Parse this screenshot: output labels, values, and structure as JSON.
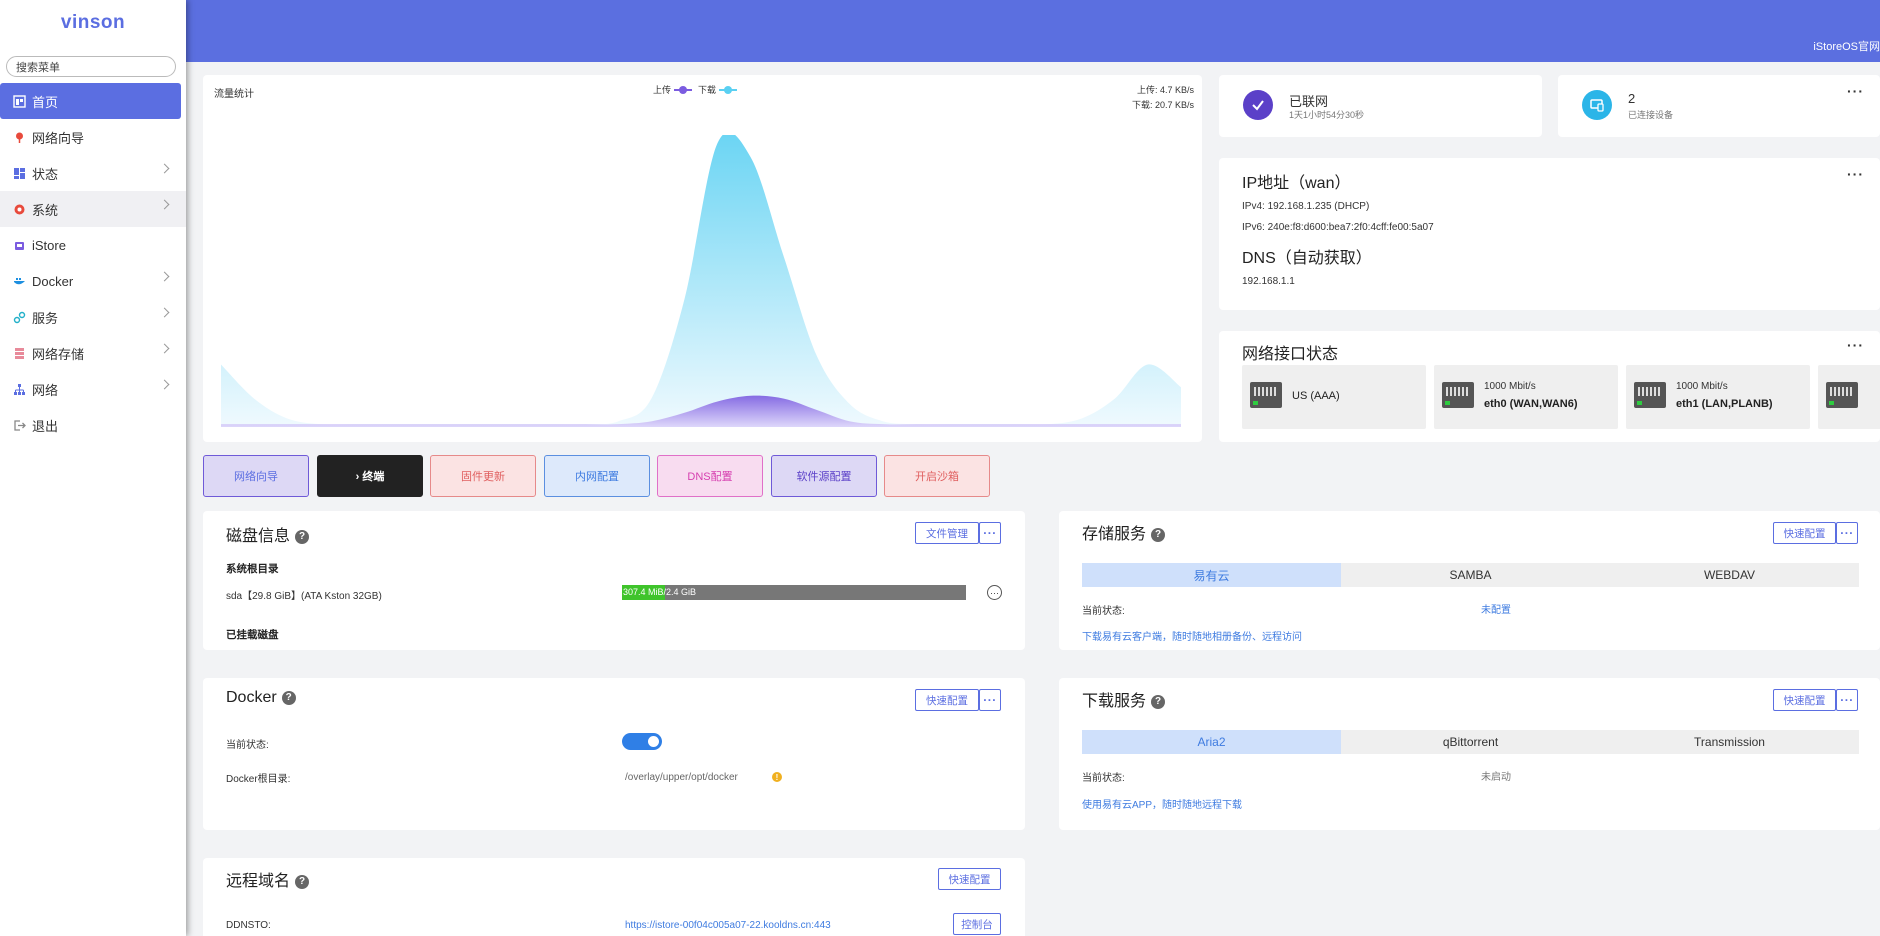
{
  "sidebar": {
    "logo": "vinson",
    "search_placeholder": "搜索菜单",
    "items": [
      {
        "label": "首页",
        "icon": "home-icon",
        "active": true
      },
      {
        "label": "网络向导",
        "icon": "wizard-icon"
      },
      {
        "label": "状态",
        "icon": "dashboard-icon",
        "has_children": true
      },
      {
        "label": "系统",
        "icon": "gear-icon",
        "has_children": true
      },
      {
        "label": "iStore",
        "icon": "store-icon"
      },
      {
        "label": "Docker",
        "icon": "docker-icon",
        "has_children": true
      },
      {
        "label": "服务",
        "icon": "services-icon",
        "has_children": true
      },
      {
        "label": "网络存储",
        "icon": "storage-icon",
        "has_children": true
      },
      {
        "label": "网络",
        "icon": "network-icon",
        "has_children": true
      },
      {
        "label": "退出",
        "icon": "logout-icon"
      }
    ]
  },
  "topbar": {
    "link": "iStoreOS官网"
  },
  "traffic": {
    "title": "流量统计",
    "legend_upload": "上传",
    "legend_download": "下载",
    "upload_rate": "上传: 4.7 KB/s",
    "download_rate": "下载: 20.7 KB/s"
  },
  "chart_data": {
    "type": "area",
    "title": "流量统计",
    "series": [
      {
        "name": "上传",
        "color": "#7b5ce0",
        "values": [
          1,
          1,
          1,
          1,
          1,
          1,
          1,
          1,
          1,
          1,
          1,
          1,
          1,
          2,
          5,
          9,
          11,
          10,
          6,
          2,
          1,
          1,
          1,
          1,
          1,
          1,
          1,
          1,
          1,
          1
        ]
      },
      {
        "name": "下载",
        "color": "#5ad0f2",
        "values": [
          22,
          10,
          3,
          1,
          1,
          1,
          1,
          1,
          1,
          1,
          1,
          1,
          2,
          10,
          45,
          100,
          95,
          60,
          25,
          8,
          2,
          1,
          1,
          1,
          1,
          1,
          3,
          10,
          22,
          14
        ]
      }
    ],
    "grid": false,
    "legend": "top-center",
    "colors": {
      "upload": "#7b5ce0",
      "download": "#5ad0f2"
    }
  },
  "status": {
    "online_label": "已联网",
    "uptime": "1天1小时54分30秒",
    "devices_count": "2",
    "devices_label": "已连接设备"
  },
  "ip": {
    "title": "IP地址（wan）",
    "ipv4": "IPv4: 192.168.1.235   (DHCP)",
    "ipv6": "IPv6: 240e:f8:d600:bea7:2f0:4cff:fe00:5a07",
    "dns_title": "DNS（自动获取）",
    "dns": "192.168.1.1"
  },
  "interfaces": {
    "title": "网络接口状态",
    "ports": [
      {
        "speed": "",
        "name": "US (AAA)"
      },
      {
        "speed": "1000 Mbit/s",
        "name": "eth0 (WAN,WAN6)"
      },
      {
        "speed": "1000 Mbit/s",
        "name": "eth1 (LAN,PLANB)"
      }
    ]
  },
  "quick_buttons": [
    {
      "label": "网络向导",
      "bg": "#ddd8f5",
      "border": "#6f5ad8",
      "color": "#5b6ee1"
    },
    {
      "label": "› 终端",
      "bg": "#222222",
      "border": "#222222",
      "color": "#ffffff"
    },
    {
      "label": "固件更新",
      "bg": "#fbe3e3",
      "border": "#e68a8a",
      "color": "#e06060"
    },
    {
      "label": "内网配置",
      "bg": "#dde9fb",
      "border": "#5b8fe0",
      "color": "#3e7be0"
    },
    {
      "label": "DNS配置",
      "bg": "#f8dcf0",
      "border": "#e070c8",
      "color": "#d63faf"
    },
    {
      "label": "软件源配置",
      "bg": "#ddd8f5",
      "border": "#6f5ad8",
      "color": "#5b40c8"
    },
    {
      "label": "开启沙箱",
      "bg": "#fbe3e3",
      "border": "#e68a8a",
      "color": "#e06060"
    }
  ],
  "disk": {
    "title": "磁盘信息",
    "file_mgmt": "文件管理",
    "root_label": "系统根目录",
    "device": "sda【29.8 GiB】(ATA Kston 32GB)",
    "usage": "307.4 MiB/2.4 GiB",
    "usage_fraction": 0.125,
    "mounted_label": "已挂载磁盘"
  },
  "storage": {
    "title": "存储服务",
    "quick": "快速配置",
    "tabs": [
      "易有云",
      "SAMBA",
      "WEBDAV"
    ],
    "status_label": "当前状态:",
    "status_value": "未配置",
    "link": "下载易有云客户端，随时随地相册备份、远程访问"
  },
  "docker": {
    "title": "Docker",
    "quick": "快速配置",
    "status_label": "当前状态:",
    "enabled": true,
    "root_label": "Docker根目录:",
    "root_value": "/overlay/upper/opt/docker"
  },
  "download": {
    "title": "下载服务",
    "quick": "快速配置",
    "tabs": [
      "Aria2",
      "qBittorrent",
      "Transmission"
    ],
    "status_label": "当前状态:",
    "status_value": "未启动",
    "link": "使用易有云APP，随时随地远程下载"
  },
  "ddns": {
    "title": "远程域名",
    "quick": "快速配置",
    "label": "DDNSTO:",
    "url": "https://istore-00f04c005a07-22.kooldns.cn:443",
    "console": "控制台"
  }
}
